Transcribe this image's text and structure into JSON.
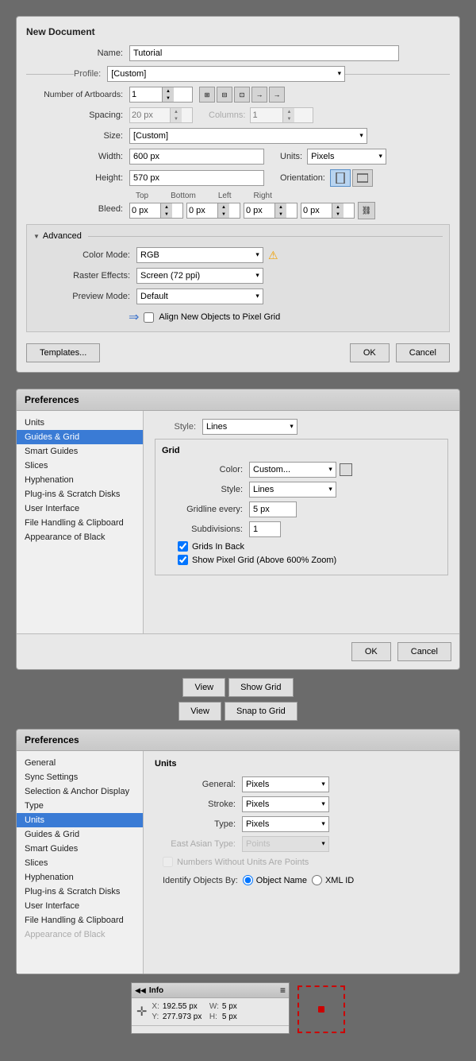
{
  "newDocument": {
    "title": "New Document",
    "nameLabel": "Name:",
    "nameValue": "Tutorial",
    "profileLabel": "Profile:",
    "profileValue": "[Custom]",
    "profileOptions": [
      "[Custom]"
    ],
    "artboardsLabel": "Number of Artboards:",
    "artboardsValue": "1",
    "spacingLabel": "Spacing:",
    "spacingValue": "20 px",
    "columnsLabel": "Columns:",
    "columnsValue": "1",
    "sizeLabel": "Size:",
    "sizeValue": "[Custom]",
    "widthLabel": "Width:",
    "widthValue": "600 px",
    "unitsLabel": "Units:",
    "unitsValue": "Pixels",
    "heightLabel": "Height:",
    "heightValue": "570 px",
    "orientationLabel": "Orientation:",
    "bleedLabel": "Bleed:",
    "bleedTop": "0 px",
    "bleedBottom": "0 px",
    "bleedLeft": "0 px",
    "bleedRight": "0 px",
    "bleedTopLabel": "Top",
    "bleedBottomLabel": "Bottom",
    "bleedLeftLabel": "Left",
    "bleedRightLabel": "Right",
    "advancedTitle": "Advanced",
    "colorModeLabel": "Color Mode:",
    "colorModeValue": "RGB",
    "rasterEffectsLabel": "Raster Effects:",
    "rasterEffectsValue": "Screen (72 ppi)",
    "previewModeLabel": "Preview Mode:",
    "previewModeValue": "Default",
    "alignCheckbox": "Align New Objects to Pixel Grid",
    "templatesBtn": "Templates...",
    "okBtn": "OK",
    "cancelBtn": "Cancel"
  },
  "preferencesTop": {
    "title": "Preferences",
    "sidebarItems": [
      "Units",
      "Guides & Grid",
      "Smart Guides",
      "Slices",
      "Hyphenation",
      "Plug-ins & Scratch Disks",
      "User Interface",
      "File Handling & Clipboard",
      "Appearance of Black"
    ],
    "activeItem": "Guides & Grid",
    "styleLabel": "Style:",
    "styleValue": "Lines",
    "gridSectionTitle": "Grid",
    "colorLabel": "Color:",
    "colorValue": "Custom...",
    "gridStyleLabel": "Style:",
    "gridStyleValue": "Lines",
    "gridlineLabel": "Gridline every:",
    "gridlineValue": "5 px",
    "subdivisionsLabel": "Subdivisions:",
    "subdivisionsValue": "1",
    "gridsInBack": "Grids In Back",
    "showPixelGrid": "Show Pixel Grid (Above 600% Zoom)",
    "okBtn": "OK",
    "cancelBtn": "Cancel"
  },
  "menuButtons": {
    "viewBtn1": "View",
    "showGridBtn": "Show Grid",
    "viewBtn2": "View",
    "snapToGridBtn": "Snap to Grid"
  },
  "preferencesBottom": {
    "title": "Preferences",
    "sidebarItems": [
      "General",
      "Sync Settings",
      "Selection & Anchor Display",
      "Type",
      "Units",
      "Guides & Grid",
      "Smart Guides",
      "Slices",
      "Hyphenation",
      "Plug-ins & Scratch Disks",
      "User Interface",
      "File Handling & Clipboard",
      "Appearance of Black"
    ],
    "activeItem": "Units",
    "sectionTitle": "Units",
    "generalLabel": "General:",
    "generalValue": "Pixels",
    "strokeLabel": "Stroke:",
    "strokeValue": "Pixels",
    "typeLabel": "Type:",
    "typeValue": "Pixels",
    "eastAsianLabel": "East Asian Type:",
    "eastAsianValue": "Points",
    "numbersCheckbox": "Numbers Without Units Are Points",
    "identifyLabel": "Identify Objects By:",
    "radioObjectName": "Object Name",
    "radioXMLID": "XML ID"
  },
  "infoPanel": {
    "title": "Info",
    "collapseBtn": "◀◀",
    "menuBtn": "≡",
    "xLabel": "X:",
    "xValue": "192.55 px",
    "yLabel": "Y:",
    "yValue": "277.973 px",
    "wLabel": "W:",
    "wValue": "5 px",
    "hLabel": "H:",
    "hValue": "5 px"
  }
}
